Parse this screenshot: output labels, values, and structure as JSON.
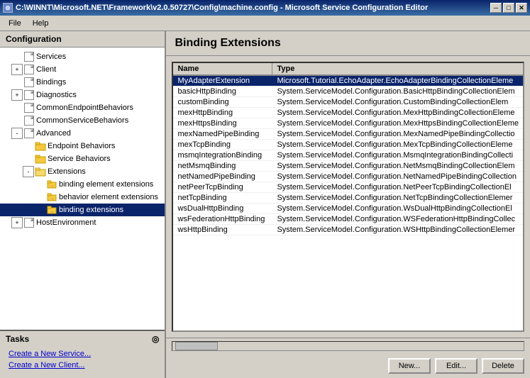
{
  "titleBar": {
    "text": "C:\\WINNT\\Microsoft.NET\\Framework\\v2.0.50727\\Config\\machine.config - Microsoft Service Configuration Editor",
    "minBtn": "─",
    "maxBtn": "□",
    "closeBtn": "✕"
  },
  "menuBar": {
    "items": [
      "File",
      "Help"
    ]
  },
  "leftPanel": {
    "header": "Configuration",
    "tree": [
      {
        "id": "services",
        "label": "Services",
        "indent": 0,
        "toggle": null,
        "icon": "page"
      },
      {
        "id": "client",
        "label": "Client",
        "indent": 0,
        "toggle": "+",
        "icon": "page"
      },
      {
        "id": "bindings",
        "label": "Bindings",
        "indent": 0,
        "toggle": null,
        "icon": "page"
      },
      {
        "id": "diagnostics",
        "label": "Diagnostics",
        "indent": 0,
        "toggle": "+",
        "icon": "page"
      },
      {
        "id": "commonendpoint",
        "label": "CommonEndpointBehaviors",
        "indent": 0,
        "toggle": null,
        "icon": "page"
      },
      {
        "id": "commonservice",
        "label": "CommonServiceBehaviors",
        "indent": 0,
        "toggle": null,
        "icon": "page"
      },
      {
        "id": "advanced",
        "label": "Advanced",
        "indent": 0,
        "toggle": "-",
        "icon": "page"
      },
      {
        "id": "endpointbehaviors",
        "label": "Endpoint Behaviors",
        "indent": 1,
        "toggle": null,
        "icon": "folder"
      },
      {
        "id": "servicebehaviors",
        "label": "Service Behaviors",
        "indent": 1,
        "toggle": null,
        "icon": "folder"
      },
      {
        "id": "extensions",
        "label": "Extensions",
        "indent": 1,
        "toggle": "-",
        "icon": "folder-open"
      },
      {
        "id": "bindingelext",
        "label": "binding element extensions",
        "indent": 2,
        "toggle": null,
        "icon": "folder-arrow"
      },
      {
        "id": "behaviorelext",
        "label": "behavior element extensions",
        "indent": 2,
        "toggle": null,
        "icon": "folder-arrow"
      },
      {
        "id": "bindingext",
        "label": "binding extensions",
        "indent": 2,
        "toggle": null,
        "icon": "folder-arrow",
        "selected": true
      },
      {
        "id": "hostenvironment",
        "label": "HostEnvironment",
        "indent": 0,
        "toggle": "+",
        "icon": "page"
      }
    ]
  },
  "tasksPanel": {
    "header": "Tasks",
    "links": [
      "Create a New Service...",
      "Create a New Client..."
    ]
  },
  "rightPanel": {
    "header": "Binding Extensions",
    "tableHeaders": [
      "Name",
      "Type"
    ],
    "rows": [
      {
        "name": "MyAdapterExtension",
        "type": "Microsoft.Tutorial.EchoAdapter.EchoAdapterBindingCollectionEleme",
        "selected": true
      },
      {
        "name": "basicHttpBinding",
        "type": "System.ServiceModel.Configuration.BasicHttpBindingCollectionElem"
      },
      {
        "name": "customBinding",
        "type": "System.ServiceModel.Configuration.CustomBindingCollectionElem"
      },
      {
        "name": "mexHttpBinding",
        "type": "System.ServiceModel.Configuration.MexHttpBindingCollectionEleme"
      },
      {
        "name": "mexHttpsBinding",
        "type": "System.ServiceModel.Configuration.MexHttpsBindingCollectionEleme"
      },
      {
        "name": "mexNamedPipeBinding",
        "type": "System.ServiceModel.Configuration.MexNamedPipeBindingCollectio"
      },
      {
        "name": "mexTcpBinding",
        "type": "System.ServiceModel.Configuration.MexTcpBindingCollectionEleme"
      },
      {
        "name": "msmqIntegrationBinding",
        "type": "System.ServiceModel.Configuration.MsmqIntegrationBindingCollecti"
      },
      {
        "name": "netMsmqBinding",
        "type": "System.ServiceModel.Configuration.NetMsmqBindingCollectionElem"
      },
      {
        "name": "netNamedPipeBinding",
        "type": "System.ServiceModel.Configuration.NetNamedPipeBindingCollection"
      },
      {
        "name": "netPeerTcpBinding",
        "type": "System.ServiceModel.Configuration.NetPeerTcpBindingCollectionEl"
      },
      {
        "name": "netTcpBinding",
        "type": "System.ServiceModel.Configuration.NetTcpBindingCollectionElemer"
      },
      {
        "name": "wsDualHttpBinding",
        "type": "System.ServiceModel.Configuration.WsDualHttpBindingCollectionEl"
      },
      {
        "name": "wsFederationHttpBinding",
        "type": "System.ServiceModel.Configuration.WSFederationHttpBindingCollec"
      },
      {
        "name": "wsHttpBinding",
        "type": "System.ServiceModel.Configuration.WSHttpBindingCollectionElemer"
      }
    ]
  },
  "buttons": {
    "new": "New...",
    "edit": "Edit...",
    "delete": "Delete"
  }
}
